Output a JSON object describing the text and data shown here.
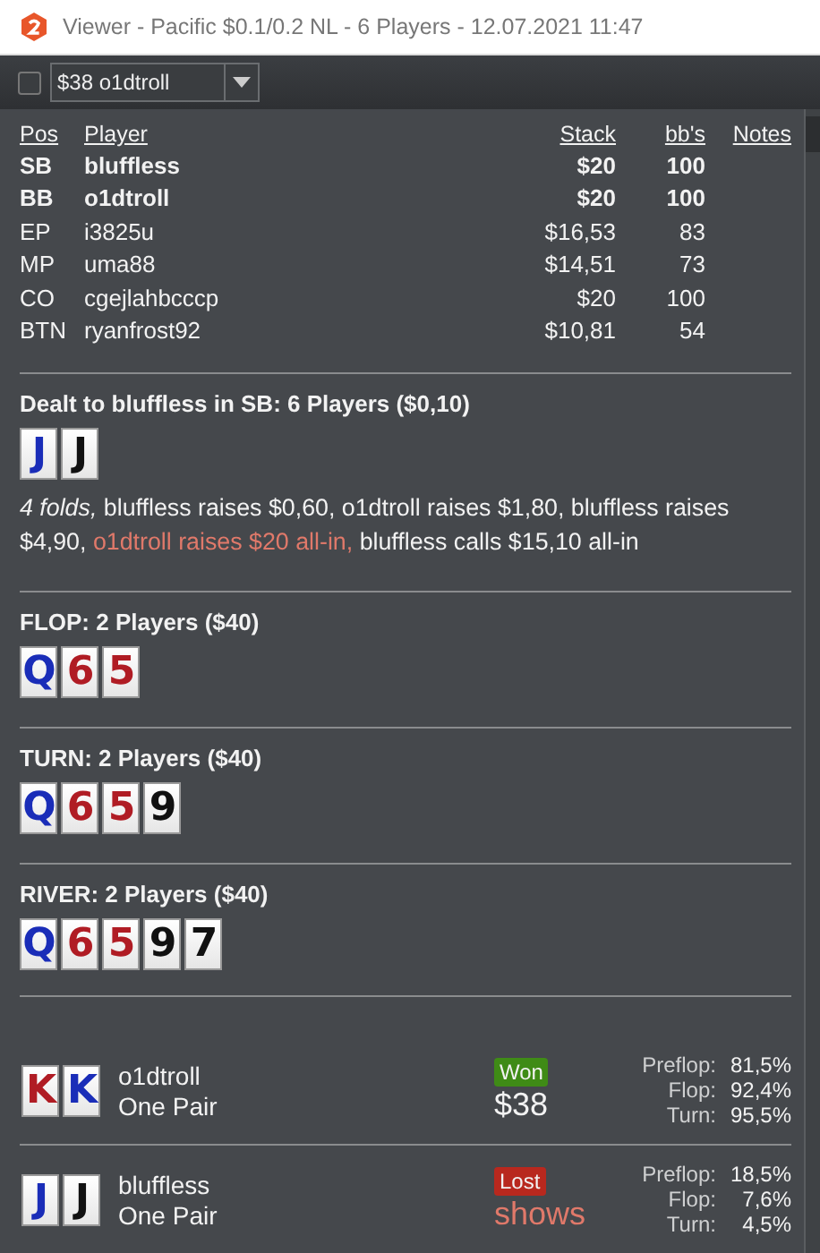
{
  "window": {
    "title": "Viewer - Pacific $0.1/0.2 NL - 6 Players - 12.07.2021 11:47"
  },
  "toolbar": {
    "checked": false,
    "selector": "$38 o1dtroll"
  },
  "table": {
    "columns": [
      "Pos",
      "Player",
      "Stack",
      "bb's",
      "Notes"
    ],
    "rows": [
      {
        "pos": "SB",
        "player": "bluffless",
        "stack": "$20",
        "bbs": "100",
        "in_hand": true
      },
      {
        "pos": "BB",
        "player": "o1dtroll",
        "stack": "$20",
        "bbs": "100",
        "in_hand": true
      },
      {
        "pos": "EP",
        "player": "i3825u",
        "stack": "$16,53",
        "bbs": "83",
        "in_hand": false
      },
      {
        "pos": "MP",
        "player": "uma88",
        "stack": "$14,51",
        "bbs": "73",
        "in_hand": false
      },
      {
        "pos": "CO",
        "player": "cgejlahbcccp",
        "stack": "$20",
        "bbs": "100",
        "in_hand": false
      },
      {
        "pos": "BTN",
        "player": "ryanfrost92",
        "stack": "$10,81",
        "bbs": "54",
        "in_hand": false
      }
    ]
  },
  "streets": [
    {
      "heading": "Dealt to bluffless in SB: 6 Players ($0,10)",
      "cards": [
        {
          "rank": "J",
          "color": "#1a2db8"
        },
        {
          "rank": "J",
          "color": "#111111"
        }
      ],
      "actions": [
        {
          "text": "4 folds,",
          "kind": "italic"
        },
        {
          "text": " bluffless raises $0,60, o1dtroll raises $1,80, bluffless raises $4,90, ",
          "kind": "plain"
        },
        {
          "text": "o1dtroll raises $20 all-in,",
          "kind": "highlight"
        },
        {
          "text": " bluffless calls $15,10 all-in",
          "kind": "plain"
        }
      ]
    },
    {
      "heading": "FLOP: 2 Players ($40)",
      "cards": [
        {
          "rank": "Q",
          "color": "#1a2db8"
        },
        {
          "rank": "6",
          "color": "#b01c24"
        },
        {
          "rank": "5",
          "color": "#b01c24"
        }
      ]
    },
    {
      "heading": "TURN: 2 Players ($40)",
      "cards": [
        {
          "rank": "Q",
          "color": "#1a2db8"
        },
        {
          "rank": "6",
          "color": "#b01c24"
        },
        {
          "rank": "5",
          "color": "#b01c24"
        },
        {
          "rank": "9",
          "color": "#111111"
        }
      ]
    },
    {
      "heading": "RIVER: 2 Players ($40)",
      "cards": [
        {
          "rank": "Q",
          "color": "#1a2db8"
        },
        {
          "rank": "6",
          "color": "#b01c24"
        },
        {
          "rank": "5",
          "color": "#b01c24"
        },
        {
          "rank": "9",
          "color": "#111111"
        },
        {
          "rank": "7",
          "color": "#111111"
        }
      ]
    }
  ],
  "results": [
    {
      "cards": [
        {
          "rank": "K",
          "color": "#b01c24"
        },
        {
          "rank": "K",
          "color": "#1a2db8"
        }
      ],
      "player": "o1dtroll",
      "hand": "One Pair",
      "kind": "won",
      "badge": "Won",
      "amount": "$38",
      "equity": [
        {
          "label": "Preflop:",
          "value": "81,5%"
        },
        {
          "label": "Flop:",
          "value": "92,4%"
        },
        {
          "label": "Turn:",
          "value": "95,5%"
        }
      ]
    },
    {
      "cards": [
        {
          "rank": "J",
          "color": "#1a2db8"
        },
        {
          "rank": "J",
          "color": "#111111"
        }
      ],
      "player": "bluffless",
      "hand": "One Pair",
      "kind": "lost",
      "badge": "Lost",
      "amount": "shows",
      "equity": [
        {
          "label": "Preflop:",
          "value": "18,5%"
        },
        {
          "label": "Flop:",
          "value": "7,6%"
        },
        {
          "label": "Turn:",
          "value": "4,5%"
        }
      ]
    }
  ]
}
